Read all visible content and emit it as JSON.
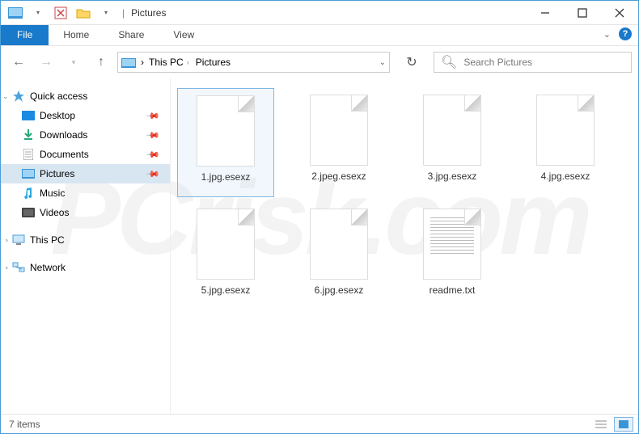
{
  "titlebar": {
    "title": "Pictures"
  },
  "ribbon": {
    "file": "File",
    "tabs": [
      "Home",
      "Share",
      "View"
    ]
  },
  "breadcrumbs": {
    "items": [
      "This PC",
      "Pictures"
    ]
  },
  "search": {
    "placeholder": "Search Pictures"
  },
  "sidebar": {
    "quick_access": "Quick access",
    "items": [
      {
        "label": "Desktop",
        "pinned": true
      },
      {
        "label": "Downloads",
        "pinned": true
      },
      {
        "label": "Documents",
        "pinned": true
      },
      {
        "label": "Pictures",
        "pinned": true,
        "selected": true
      },
      {
        "label": "Music",
        "pinned": false
      },
      {
        "label": "Videos",
        "pinned": false
      }
    ],
    "this_pc": "This PC",
    "network": "Network"
  },
  "files": [
    {
      "name": "1.jpg.esexz",
      "type": "blank",
      "selected": true
    },
    {
      "name": "2.jpeg.esexz",
      "type": "blank"
    },
    {
      "name": "3.jpg.esexz",
      "type": "blank"
    },
    {
      "name": "4.jpg.esexz",
      "type": "blank"
    },
    {
      "name": "5.jpg.esexz",
      "type": "blank"
    },
    {
      "name": "6.jpg.esexz",
      "type": "blank"
    },
    {
      "name": "readme.txt",
      "type": "text"
    }
  ],
  "statusbar": {
    "count_label": "7 items"
  }
}
